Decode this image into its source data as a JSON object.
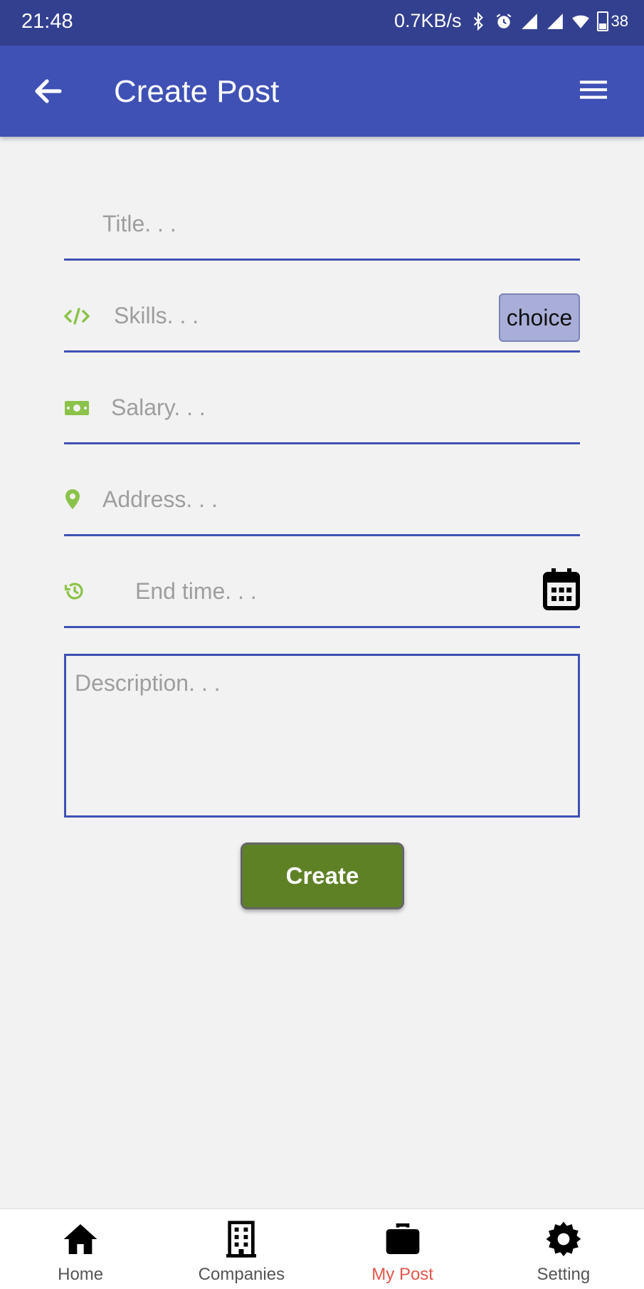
{
  "status_bar": {
    "time": "21:48",
    "network_speed": "0.7KB/s",
    "battery": "38"
  },
  "app_bar": {
    "title": "Create Post"
  },
  "form": {
    "title": {
      "placeholder": "Title. . .",
      "value": ""
    },
    "skills": {
      "placeholder": "Skills. . .",
      "value": "",
      "choice_label": "choice",
      "icon": "code-icon"
    },
    "salary": {
      "placeholder": "Salary. . .",
      "value": "",
      "icon": "money-icon"
    },
    "address": {
      "placeholder": "Address. . .",
      "value": "",
      "icon": "location-pin-icon"
    },
    "end_time": {
      "placeholder": "End time. . .",
      "value": "",
      "icon": "history-icon",
      "picker_icon": "calendar-icon"
    },
    "description": {
      "placeholder": "Description. . .",
      "value": ""
    },
    "submit_label": "Create"
  },
  "bottom_nav": {
    "items": [
      {
        "label": "Home",
        "icon": "home-icon"
      },
      {
        "label": "Companies",
        "icon": "building-icon"
      },
      {
        "label": "My Post",
        "icon": "briefcase-icon",
        "active": true
      },
      {
        "label": "Setting",
        "icon": "gear-icon"
      }
    ]
  },
  "colors": {
    "status_bar": "#33408f",
    "app_bar": "#3f51b5",
    "accent_icon": "#8bc34a",
    "create_button": "#5e8126",
    "choice_button": "#a8aed8",
    "active_nav": "#e2574c"
  }
}
